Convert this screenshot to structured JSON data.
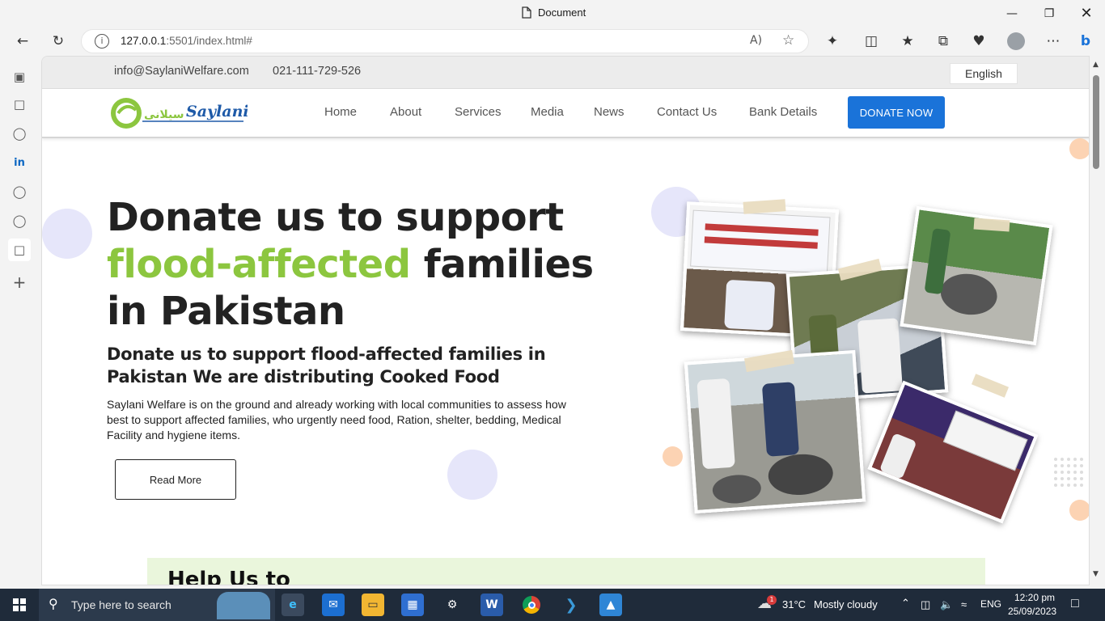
{
  "window": {
    "title": "Document"
  },
  "browser": {
    "url_host": "127.0.0.1",
    "url_rest": ":5501/index.html#"
  },
  "site": {
    "email": "info@SaylaniWelfare.com",
    "phone": "021-111-729-526",
    "language": "English",
    "logo_text": "Saylani",
    "nav": [
      "Home",
      "About",
      "Services",
      "Media",
      "News",
      "Contact Us",
      "Bank Details"
    ],
    "donate_label": "DONATE NOW",
    "hero": {
      "title_line1": "Donate us to support",
      "title_green": "flood-affected",
      "title_line2_rest": " families",
      "title_line3": "in Pakistan",
      "subtitle": "Donate us to support flood-affected families in Pakistan We are distributing Cooked Food",
      "body": "Saylani Welfare is on the ground and already working with local communities to assess how best to support affected families, who urgently need food, Ration, shelter, bedding, Medical Facility and hygiene items.",
      "read_more": "Read More"
    },
    "help_heading": "Help Us to"
  },
  "taskbar": {
    "search_placeholder": "Type here to search",
    "weather_temp": "31°C",
    "weather_text": "Mostly cloudy",
    "lang": "ENG",
    "time": "12:20 pm",
    "date": "25/09/2023",
    "weather_badge": "1"
  },
  "colors": {
    "accent_green": "#8cc63f",
    "donate_blue": "#1a73d9",
    "help_bg": "#eaf6dc"
  }
}
